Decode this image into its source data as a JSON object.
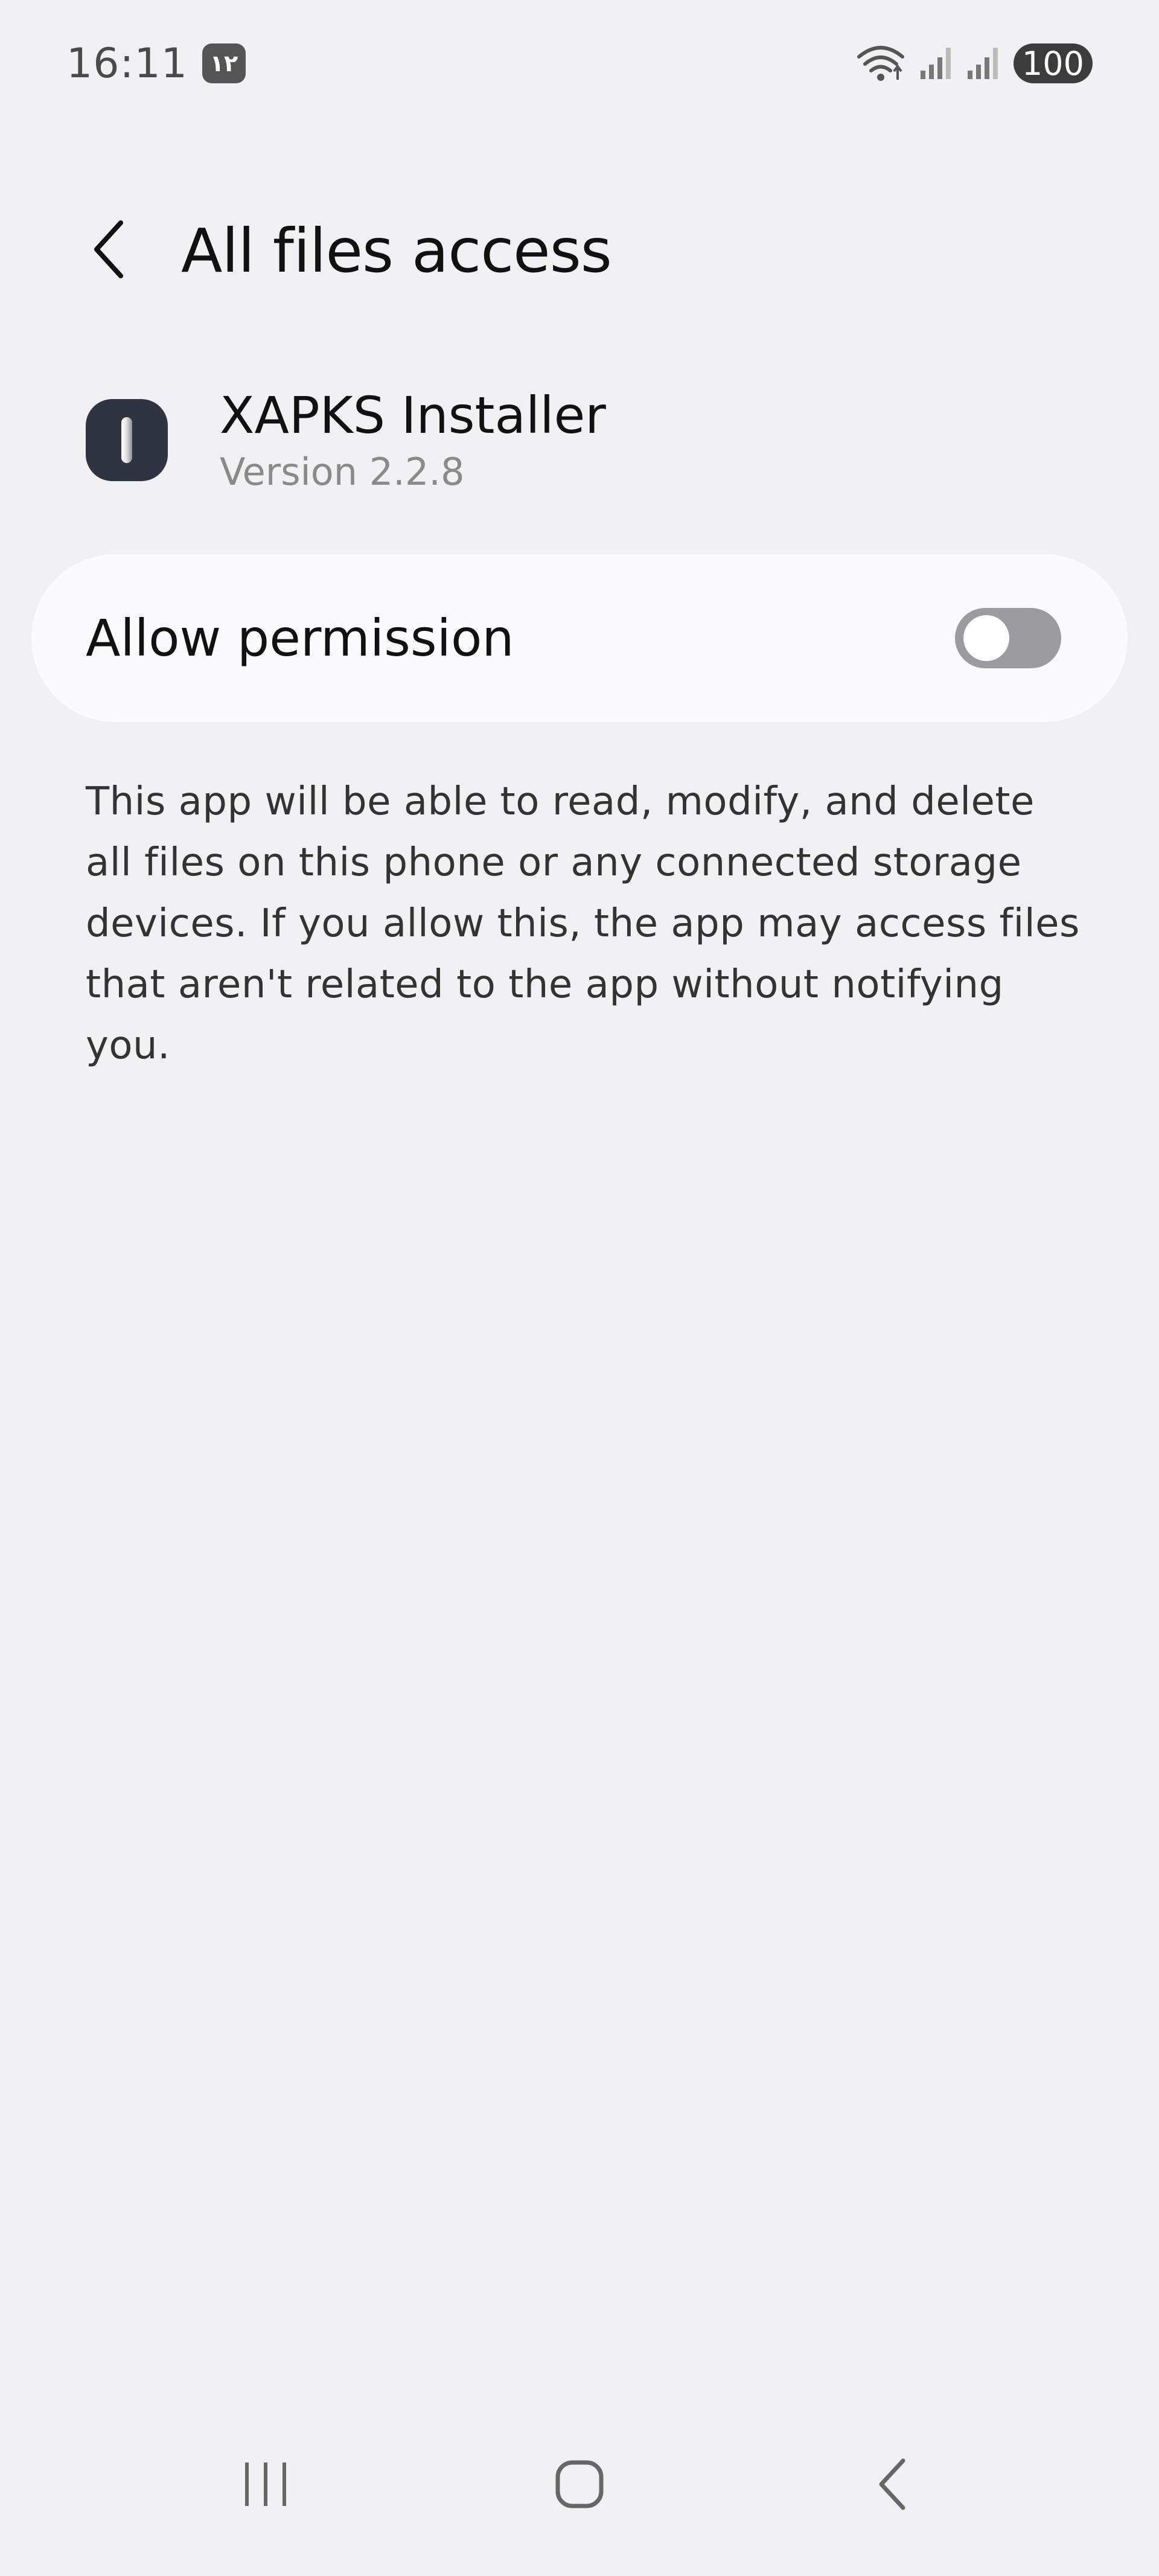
{
  "status_bar": {
    "time": "16:11",
    "notification_badge": "۱۲",
    "battery": "100",
    "icons": [
      "wifi-icon",
      "signal-icon-1",
      "signal-icon-2"
    ]
  },
  "header": {
    "title": "All files access",
    "back_icon": "chevron-left-icon"
  },
  "app": {
    "name": "XAPKS Installer",
    "version": "Version 2.2.8",
    "icon": "xapks-app-icon"
  },
  "permission": {
    "label": "Allow permission",
    "enabled": false
  },
  "description": "This app will be able to read, modify, and delete all files on this phone or any connected storage devices. If you allow this, the app may access files that aren't related to the app without notifying you.",
  "nav_bar": {
    "recents_icon": "recents-icon",
    "home_icon": "home-icon",
    "back_icon": "back-icon"
  },
  "colors": {
    "background": "#f1f1f3",
    "card": "#fbfbfd",
    "toggle_off": "#9c9ca0",
    "app_icon": "#2e3540"
  }
}
